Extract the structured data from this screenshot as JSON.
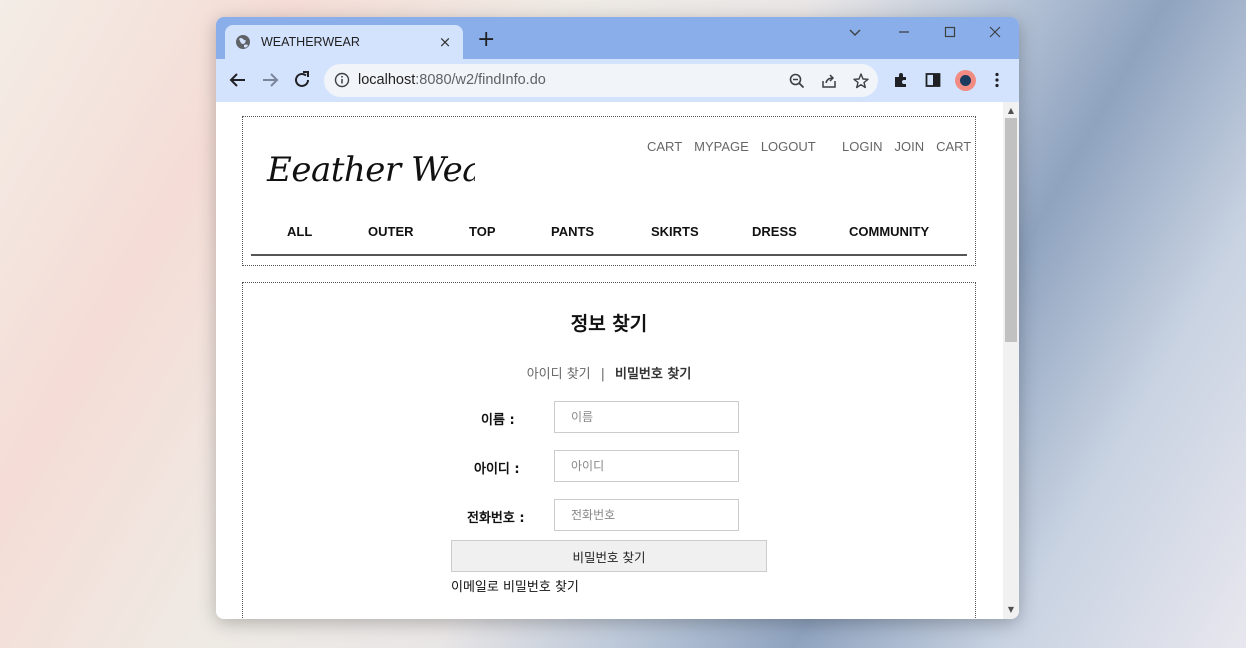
{
  "browser": {
    "tab_title": "WEATHERWEAR",
    "tab_close": "×",
    "new_tab": "+",
    "url_host": "localhost",
    "url_rest": ":8080/w2/findInfo.do"
  },
  "header": {
    "logo_text": "Eeather Wear",
    "links_left": [
      "CART",
      "MYPAGE",
      "LOGOUT"
    ],
    "links_right": [
      "LOGIN",
      "JOIN",
      "CART"
    ],
    "menu": [
      "ALL",
      "OUTER",
      "TOP",
      "PANTS",
      "SKIRTS",
      "DRESS",
      "COMMUNITY"
    ]
  },
  "main": {
    "title": "정보 찾기",
    "tab_find_id": "아이디 찾기",
    "tab_separator": "|",
    "tab_find_pw": "비밀번호 찾기",
    "fields": [
      {
        "label": "이름 :",
        "placeholder": "이름"
      },
      {
        "label": "아이디 :",
        "placeholder": "아이디"
      },
      {
        "label": "전화번호 :",
        "placeholder": "전화번호"
      }
    ],
    "submit_label": "비밀번호 찾기",
    "email_link": "이메일로 비밀번호 찾기"
  },
  "colors": {
    "tabstrip": "#8aaee9",
    "toolbar": "#d3e3fd",
    "button_bg": "#f0f0f0"
  }
}
